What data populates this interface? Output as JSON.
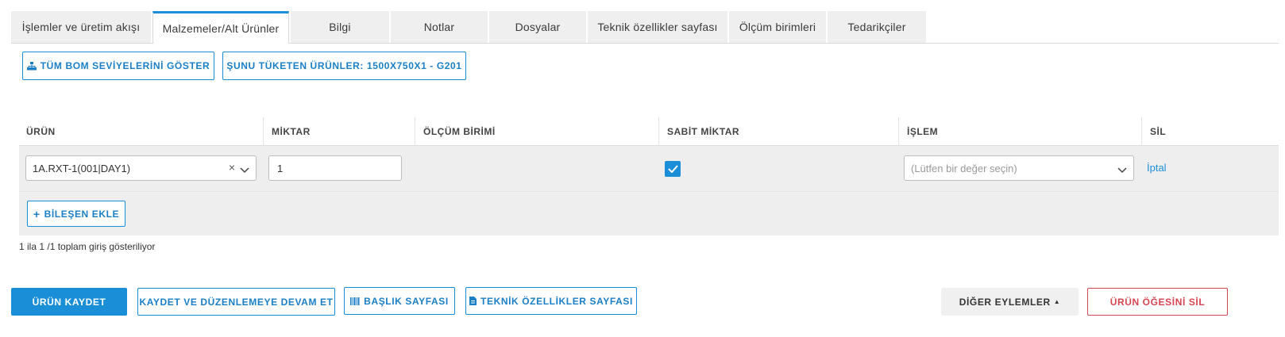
{
  "tabs": [
    {
      "label": "İşlemler ve üretim akışı"
    },
    {
      "label": "Malzemeler/Alt Ürünler"
    },
    {
      "label": "Bilgi"
    },
    {
      "label": "Notlar"
    },
    {
      "label": "Dosyalar"
    },
    {
      "label": "Teknik özellikler sayfası"
    },
    {
      "label": "Ölçüm birimleri"
    },
    {
      "label": "Tedarikçiler"
    }
  ],
  "active_tab": "Malzemeler/Alt Ürünler",
  "toolbar": {
    "show_bom_label": "TÜM BOM SEVİYELERİNİ GÖSTER",
    "consumers_label": "ŞUNU TÜKETEN ÜRÜNLER: 1500X750X1 - G201"
  },
  "table": {
    "columns": [
      "ÜRÜN",
      "MİKTAR",
      "ÖLÇÜM BİRİMİ",
      "SABİT MİKTAR",
      "İŞLEM",
      "SİL"
    ],
    "rows": [
      {
        "product": "1A.RXT-1(001|DAY1)",
        "quantity": "1",
        "unit": "",
        "fixed_quantity": true,
        "operation_placeholder": "(Lütfen bir değer seçin)",
        "delete_label": "İptal"
      }
    ],
    "add_component_label": "BİLEŞEN EKLE"
  },
  "info_text": "1 ila 1 /1 toplam giriş gösteriliyor",
  "footer": {
    "save_label": "ÜRÜN KAYDET",
    "save_continue_label": "KAYDET VE DÜZENLEMEYE DEVAM ET",
    "header_page_label": "BAŞLIK SAYFASI",
    "spec_page_label": "TEKNİK ÖZELLİKLER SAYFASI",
    "other_actions_label": "DİĞER EYLEMLER",
    "delete_item_label": "ÜRÜN ÖĞESİNİ SİL"
  },
  "colors": {
    "accent": "#1a8fd8",
    "danger": "#d64550",
    "row_bg": "#eeeeee"
  }
}
